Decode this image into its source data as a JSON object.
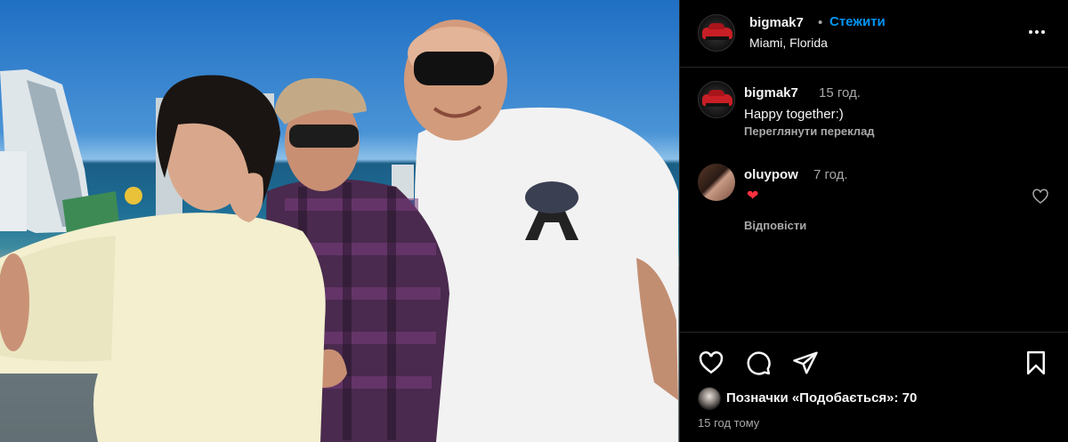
{
  "post": {
    "username": "bigmak7",
    "separator": "•",
    "follow_label": "Стежити",
    "location": "Miami, Florida"
  },
  "caption": {
    "username": "bigmak7",
    "time": "15 год.",
    "text": "Happy together:)",
    "translate_label": "Переглянути переклад"
  },
  "comment": {
    "username": "oluypow",
    "time": "7 год.",
    "text": "❤",
    "reply_label": "Відповісти"
  },
  "actions": {
    "icons": [
      "heart-icon",
      "comment-bubble-icon",
      "paper-plane-icon",
      "bookmark-icon"
    ]
  },
  "likes": {
    "label_prefix": "Позначки «Подобається»: ",
    "count": "70"
  },
  "timestamp": "15 год тому",
  "colors": {
    "background": "#000000",
    "text": "#f5f5f5",
    "secondary_text": "#a8a8a8",
    "follow_blue": "#0095f6",
    "heart_red": "#ff3040",
    "divider": "#262626"
  }
}
